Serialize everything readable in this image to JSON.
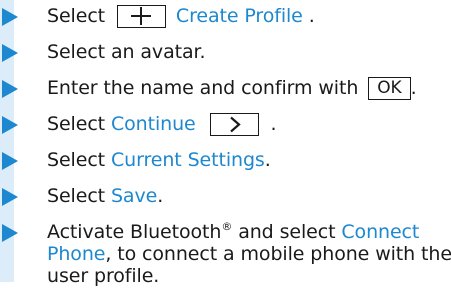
{
  "steps": [
    {
      "before": "Select",
      "link": "Create Profile",
      "after": " ."
    },
    {
      "text": "Select an avatar."
    },
    {
      "text": "Enter the name and confirm with",
      "key": "OK",
      "after": "."
    },
    {
      "before": "Select ",
      "link": "Continue",
      "after": " ."
    },
    {
      "before": "Select ",
      "link": "Current Settings",
      "after": "."
    },
    {
      "before": "Select ",
      "link": "Save",
      "after": "."
    },
    {
      "line1": "Activate Bluetooth",
      "reg": "®",
      "line1_mid": " and select ",
      "link_part1": "Connect",
      "link_part2": "Phone",
      "line2_rest": ", to connect a mobile phone with the",
      "line3": "user profile."
    }
  ],
  "icons": [
    "plus-icon",
    "chevron-right-icon",
    "arrow-bullet-icon"
  ],
  "colors": {
    "accent": "#1d88cf",
    "rail": "#dcecf8",
    "text": "#1a1a1a"
  }
}
